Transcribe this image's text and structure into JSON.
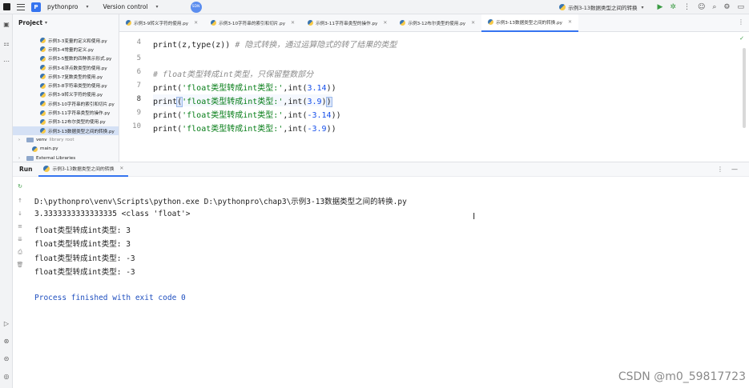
{
  "titlebar": {
    "project_badge": "P",
    "project_name": "pythonpro",
    "vcs_label": "Version control",
    "sdn_badge": "SDN",
    "run_config": "示例3-13数据类型之间的转换"
  },
  "project_panel": {
    "title": "Project",
    "files": [
      "示例3-3变量的定义和使用.py",
      "示例3-4常量的定义.py",
      "示例3-5整数的四种表示形式.py",
      "示例3-6浮点数类型的使用.py",
      "示例3-7复数类型的使用.py",
      "示例3-8字符串类型的使用.py",
      "示例3-9转义字符的使用.py",
      "示例3-10字符串的索引和切片.py",
      "示例3-11字符串类型的操作.py",
      "示例3-12布尔类型的使用.py",
      "示例3-13数据类型之间的转换.py"
    ],
    "venv_label": "venv",
    "venv_note": "library root",
    "main_label": "main.py",
    "external_label": "External Libraries"
  },
  "tabs": [
    "示例3-9转义字符的使用.py",
    "示例3-10字符串的索引和切片.py",
    "示例3-11字符串类型的操作.py",
    "示例3-12布尔类型的使用.py",
    "示例3-13数据类型之间的转换.py"
  ],
  "editor": {
    "line_numbers": [
      "4",
      "5",
      "6",
      "7",
      "8",
      "9",
      "10"
    ],
    "line4_code": "print(z,type(z)) ",
    "line4_comment": "# 隐式转换，通过运算隐式的转了结果的类型",
    "line6_comment": "# float类型转成int类型，只保留整数部分",
    "line7": {
      "pre": "print(",
      "str": "'float类型转成int类型:'",
      "mid": ",int(",
      "num": "3.14",
      "post": "))"
    },
    "line8": {
      "pre": "print",
      "open": "(",
      "str": "'float类型转成int类型:'",
      "mid": ",int(",
      "num": "3.9",
      "close1": ")",
      "close2": ")"
    },
    "line9": {
      "pre": "print(",
      "str": "'float类型转成int类型:'",
      "mid": ",int(",
      "num": "-3.14",
      "post": "))"
    },
    "line10": {
      "pre": "print(",
      "str": "'float类型转成int类型:'",
      "mid": ",int(",
      "num": "-3.9",
      "post": "))"
    }
  },
  "run_panel": {
    "title": "Run",
    "tab_label": "示例3-13数据类型之间的转换",
    "command": "D:\\pythonpro\\venv\\Scripts\\python.exe D:\\pythonpro\\chap3\\示例3-13数据类型之间的转换.py",
    "output": [
      "3.3333333333333335 <class 'float'>",
      "float类型转成int类型: 3",
      "float类型转成int类型: 3",
      "float类型转成int类型: -3",
      "float类型转成int类型: -3"
    ],
    "exit_message": "Process finished with exit code 0"
  },
  "watermark": "CSDN @m0_59817723",
  "colors": {
    "accent": "#3574f0",
    "string": "#067d17",
    "number": "#1750eb",
    "comment": "#8c8c8c",
    "run_green": "#3a9b43"
  },
  "icons": [
    "menu-icon",
    "run-icon",
    "debug-icon",
    "user-icon",
    "search-icon",
    "settings-icon",
    "folder-icon",
    "python-file-icon"
  ]
}
